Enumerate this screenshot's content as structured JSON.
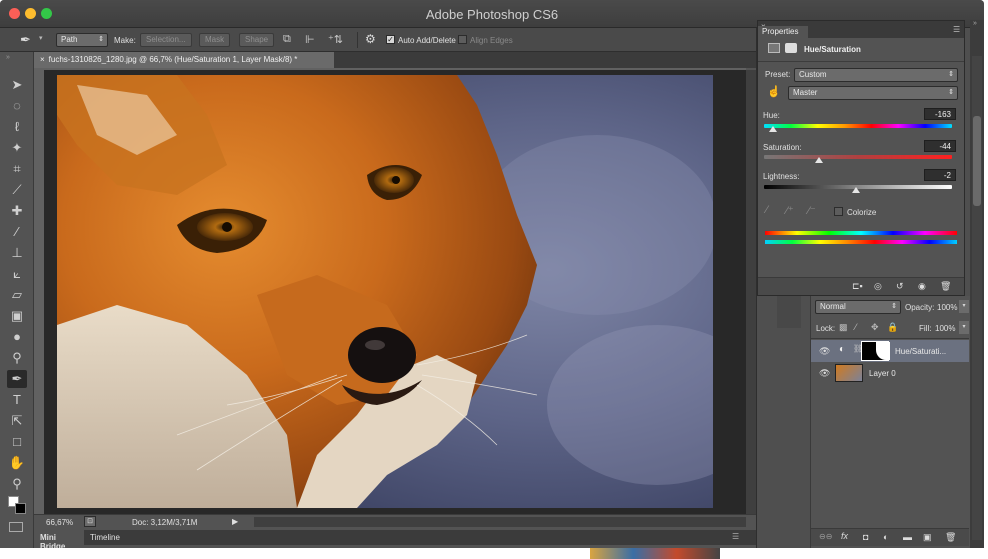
{
  "app": {
    "title": "Adobe Photoshop CS6",
    "colors": {
      "close": "#fc5f57",
      "minimize": "#fdbc2e",
      "zoom": "#33c748"
    }
  },
  "options_bar": {
    "tool_icon": "pen-tool-icon",
    "mode_value": "Path",
    "make_label": "Make:",
    "selection_button": "Selection...",
    "mask_button": "Mask",
    "shape_button": "Shape",
    "auto_add_delete_label": "Auto Add/Delete",
    "align_edges_label": "Align Edges"
  },
  "document": {
    "tab_title": "fuchs-1310826_1280.jpg @ 66,7% (Hue/Saturation 1, Layer Mask/8) *",
    "zoom": "66,67%",
    "doc_size": "Doc: 3,12M/3,71M"
  },
  "bottom_tabs": [
    "Mini Bridge",
    "Timeline"
  ],
  "properties": {
    "tab_label": "Properties",
    "adjustment_title": "Hue/Saturation",
    "preset_label": "Preset:",
    "preset_value": "Custom",
    "channel_value": "Master",
    "hue_label": "Hue:",
    "hue_value": "-163",
    "hue_position": 0.05,
    "saturation_label": "Saturation:",
    "saturation_value": "-44",
    "saturation_position": 0.29,
    "lightness_label": "Lightness:",
    "lightness_value": "-2",
    "lightness_position": 0.49,
    "colorize_label": "Colorize"
  },
  "layers": {
    "blend_mode": "Normal",
    "opacity_label": "Opacity:",
    "opacity_value": "100%",
    "lock_label": "Lock:",
    "fill_label": "Fill:",
    "fill_value": "100%",
    "items": [
      {
        "name": "Hue/Saturati...",
        "selected": true
      },
      {
        "name": "Layer 0",
        "selected": false
      }
    ]
  }
}
